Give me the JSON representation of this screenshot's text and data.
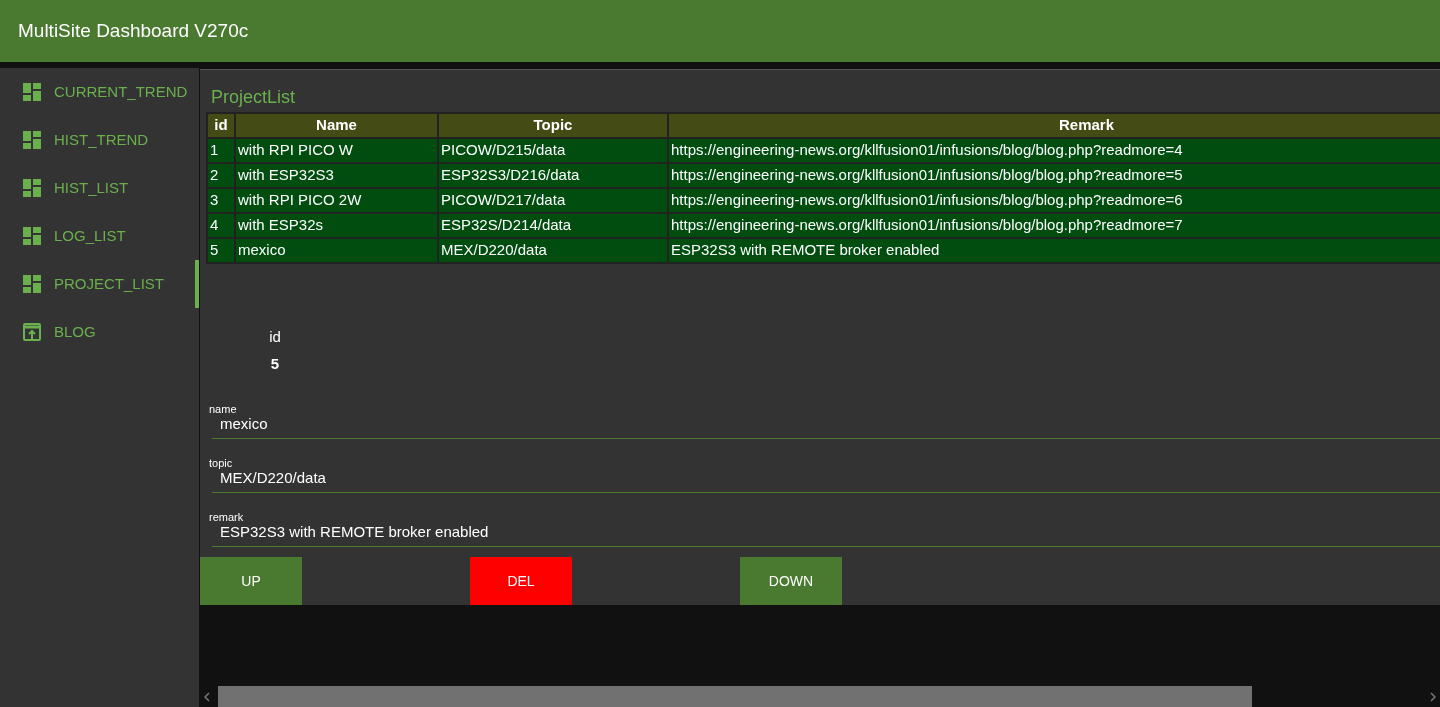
{
  "header": {
    "title": "MultiSite Dashboard V270c"
  },
  "sidebar": {
    "items": [
      {
        "label": "CURRENT_TREND",
        "kind": "dashboard",
        "selected": false
      },
      {
        "label": "HIST_TREND",
        "kind": "dashboard",
        "selected": false
      },
      {
        "label": "HIST_LIST",
        "kind": "dashboard",
        "selected": false
      },
      {
        "label": "LOG_LIST",
        "kind": "dashboard",
        "selected": false
      },
      {
        "label": "PROJECT_LIST",
        "kind": "dashboard",
        "selected": true
      },
      {
        "label": "BLOG",
        "kind": "link",
        "selected": false
      }
    ]
  },
  "panel": {
    "title": "ProjectList"
  },
  "table": {
    "columns": [
      "id",
      "Name",
      "Topic",
      "Remark"
    ],
    "rows": [
      [
        "1",
        "with RPI PICO W",
        "PICOW/D215/data",
        "https://engineering-news.org/kllfusion01/infusions/blog/blog.php?readmore=4"
      ],
      [
        "2",
        "with ESP32S3",
        "ESP32S3/D216/data",
        "https://engineering-news.org/kllfusion01/infusions/blog/blog.php?readmore=5"
      ],
      [
        "3",
        "with RPI PICO 2W",
        "PICOW/D217/data",
        "https://engineering-news.org/kllfusion01/infusions/blog/blog.php?readmore=6"
      ],
      [
        "4",
        "with ESP32s",
        "ESP32S/D214/data",
        "https://engineering-news.org/kllfusion01/infusions/blog/blog.php?readmore=7"
      ],
      [
        "5",
        "mexico",
        "MEX/D220/data",
        "ESP32S3 with REMOTE broker enabled"
      ]
    ]
  },
  "form": {
    "id_label": "id",
    "id_value": "5",
    "fields": [
      {
        "label": "name",
        "value": "mexico"
      },
      {
        "label": "topic",
        "value": "MEX/D220/data"
      },
      {
        "label": "remark",
        "value": "ESP32S3 with REMOTE broker enabled"
      }
    ],
    "buttons": [
      {
        "label": "UP",
        "kind": "normal"
      },
      {
        "label": "DEL",
        "kind": "danger"
      },
      {
        "label": "DOWN",
        "kind": "normal"
      }
    ]
  }
}
